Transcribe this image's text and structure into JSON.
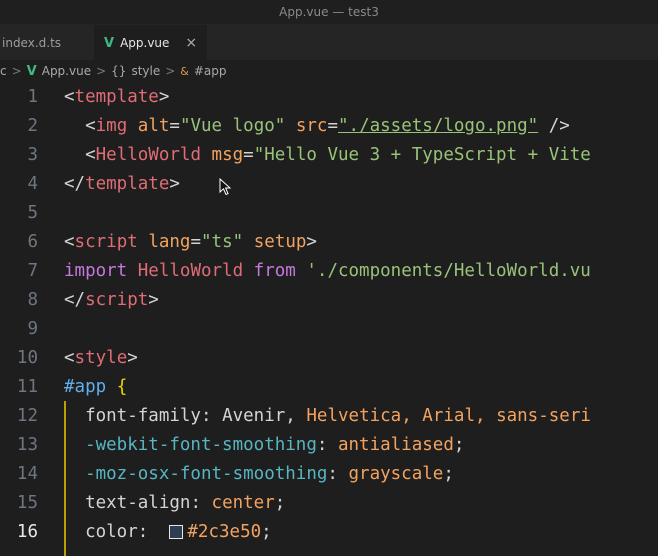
{
  "window": {
    "title": "App.vue — test3"
  },
  "tabs": [
    {
      "label": "index.d.ts",
      "active": false
    },
    {
      "label": "App.vue",
      "active": true,
      "close": "×"
    }
  ],
  "breadcrumb": {
    "prefix": "c",
    "file": "App.vue",
    "section": "style",
    "symbol": "#app",
    "sep": ">"
  },
  "editor": {
    "current_line": 16,
    "lines": [
      {
        "n": "1"
      },
      {
        "n": "2"
      },
      {
        "n": "3"
      },
      {
        "n": "4"
      },
      {
        "n": "5"
      },
      {
        "n": "6"
      },
      {
        "n": "7"
      },
      {
        "n": "8"
      },
      {
        "n": "9"
      },
      {
        "n": "10"
      },
      {
        "n": "11"
      },
      {
        "n": "12"
      },
      {
        "n": "13"
      },
      {
        "n": "14"
      },
      {
        "n": "15"
      },
      {
        "n": "16"
      }
    ],
    "code": {
      "l1_tag": "template",
      "l2_tag": "img",
      "l2_attr1": "alt",
      "l2_val1": "\"Vue logo\"",
      "l2_attr2": "src",
      "l2_val2": "\"./assets/logo.png\"",
      "l3_tag": "HelloWorld",
      "l3_attr": "msg",
      "l3_val": "\"Hello Vue 3 + TypeScript + Vite",
      "l4_tag": "template",
      "l6_tag": "script",
      "l6_attr1": "lang",
      "l6_val1": "\"ts\"",
      "l6_attr2": "setup",
      "l7_kw1": "import",
      "l7_id": "HelloWorld",
      "l7_kw2": "from",
      "l7_str": "'./components/HelloWorld.vu",
      "l8_tag": "script",
      "l10_tag": "style",
      "l11_sel": "#app",
      "l12_prop": "font-family",
      "l12_v1": "Avenir,",
      "l12_v2": "Helvetica,",
      "l12_v3": "Arial,",
      "l12_v4": "sans-seri",
      "l13_prop": "-webkit-font-smoothing",
      "l13_val": "antialiased",
      "l14_prop": "-moz-osx-font-smoothing",
      "l14_val": "grayscale",
      "l15_prop": "text-align",
      "l15_val": "center",
      "l16_prop": "color",
      "l16_val": "#2c3e50"
    }
  },
  "colors": {
    "background": "#1e1e1e",
    "swatch": "#2c3e50",
    "vue_green": "#42b883"
  }
}
